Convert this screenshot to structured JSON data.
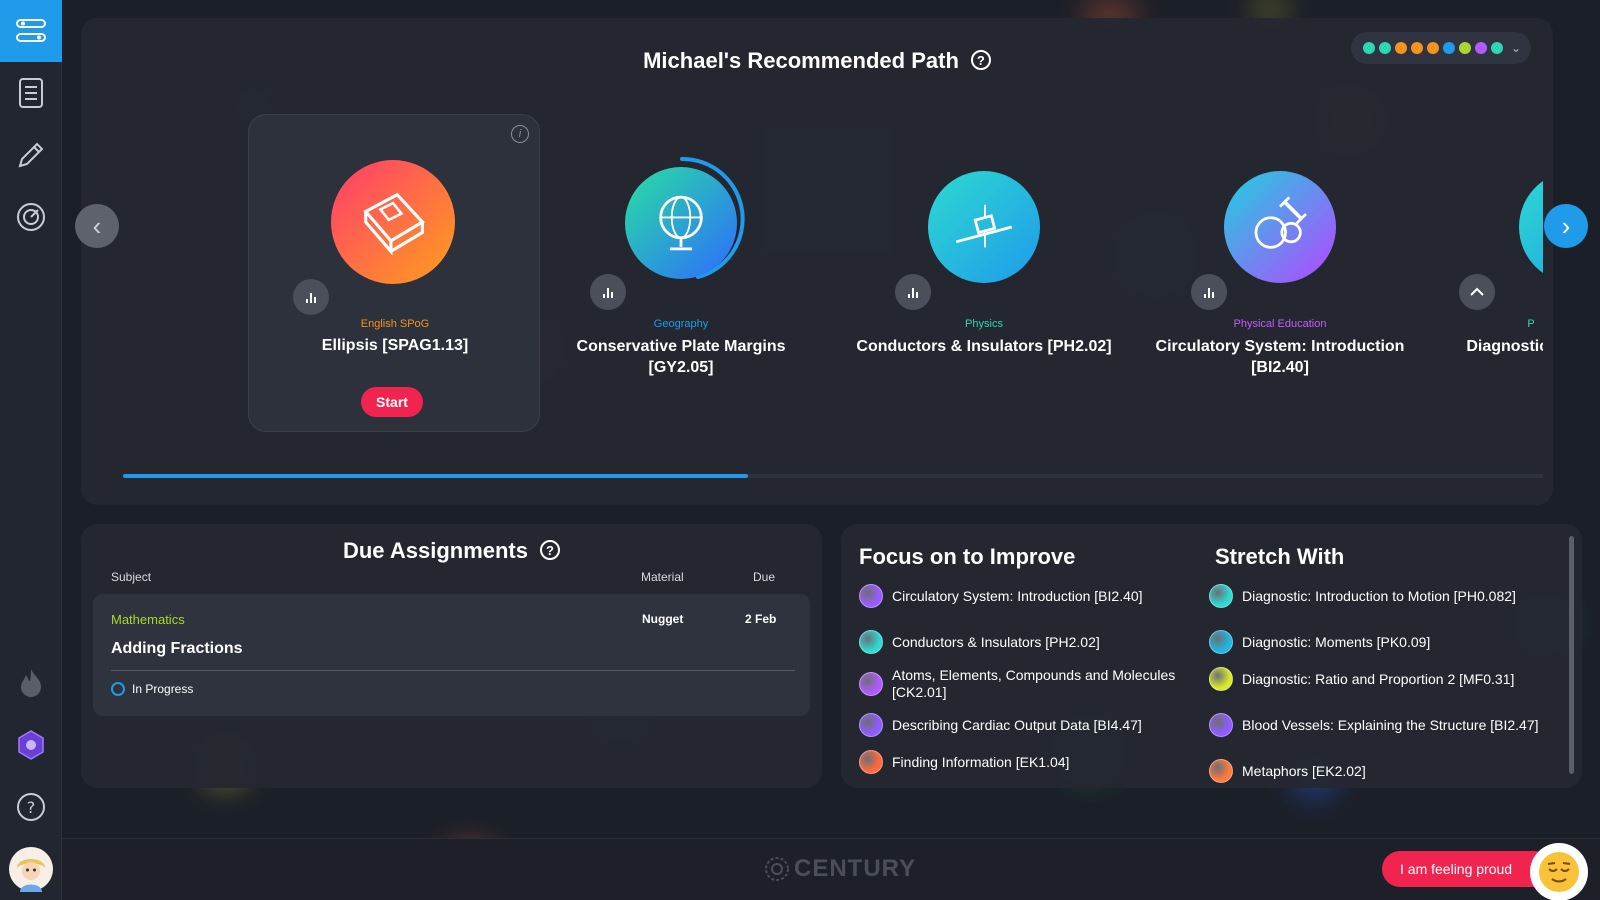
{
  "sidebar": {
    "items": [
      {
        "icon": "path-icon",
        "active": true
      },
      {
        "icon": "assignments-icon"
      },
      {
        "icon": "pencil-icon"
      },
      {
        "icon": "dashboard-icon"
      },
      {
        "icon": "flame-icon"
      },
      {
        "icon": "badge-icon"
      },
      {
        "icon": "help-icon"
      },
      {
        "icon": "avatar-icon"
      }
    ]
  },
  "recommended_path": {
    "title": "Michael's Recommended Path",
    "help_glyph": "?",
    "color_dots": [
      "#2fd6b4",
      "#2fd6b4",
      "#f7941d",
      "#f7941d",
      "#f7941d",
      "#1f9bea",
      "#a8d82d",
      "#b05bff",
      "#2fd6b4"
    ],
    "scroll_progress": 0.44,
    "cards": [
      {
        "subject": "English SPoG",
        "subject_color": "#f7941d",
        "title": "Ellipsis [SPAG1.13]",
        "button": "Start",
        "colors": [
          "#ff3c6d",
          "#ff9f1c"
        ],
        "icon": "book-icon"
      },
      {
        "subject": "Geography",
        "subject_color": "#1f9bea",
        "title": "Conservative Plate Margins [GY2.05]",
        "colors": [
          "#29e0a0",
          "#2d6bff"
        ],
        "icon": "globe-icon"
      },
      {
        "subject": "Physics",
        "subject_color": "#2fd6b4",
        "title": "Conductors & Insulators [PH2.02]",
        "colors": [
          "#2dd9d1",
          "#1f9bea"
        ],
        "icon": "physics-icon"
      },
      {
        "subject": "Physical Education",
        "subject_color": "#c45cff",
        "title": "Circulatory System: Introduction [BI2.40]",
        "colors": [
          "#1fd1e0",
          "#b446ff"
        ],
        "icon": "sports-icon"
      },
      {
        "subject": "P",
        "subject_color": "#2fd6b4",
        "title": "Diagnostic: Intr [PH",
        "colors": [
          "#2dd9d1",
          "#1f9bea"
        ],
        "icon": "physics-icon"
      }
    ]
  },
  "due_assignments": {
    "title": "Due Assignments",
    "headers": {
      "subject": "Subject",
      "material": "Material",
      "due": "Due"
    },
    "rows": [
      {
        "subject": "Mathematics",
        "material": "Nugget",
        "due": "2 Feb",
        "title": "Adding Fractions",
        "status": "In Progress"
      }
    ]
  },
  "focus": {
    "title": "Focus on to Improve",
    "items": [
      {
        "label": "Circulatory System: Introduction [BI2.40]",
        "color": "#9b5cff"
      },
      {
        "label": "Conductors & Insulators [PH2.02]",
        "color": "#2dd9d1"
      },
      {
        "label": "Atoms, Elements, Compounds and Molecules [CK2.01]",
        "color": "#b05bff"
      },
      {
        "label": "Describing Cardiac Output Data [BI4.47]",
        "color": "#8f5cff"
      },
      {
        "label": "Finding Information [EK1.04]",
        "color": "#ff6a3d"
      }
    ]
  },
  "stretch": {
    "title": "Stretch With",
    "items": [
      {
        "label": "Diagnostic: Introduction to Motion [PH0.082]",
        "color": "#2dd9d1"
      },
      {
        "label": "Diagnostic: Moments [PK0.09]",
        "color": "#1fb6e0"
      },
      {
        "label": "Diagnostic: Ratio and Proportion 2 [MF0.31]",
        "color": "#d7e82d"
      },
      {
        "label": "Blood Vessels: Explaining the Structure [BI2.47]",
        "color": "#8f5cff"
      },
      {
        "label": "Metaphors [EK2.02]",
        "color": "#ff7a3d"
      }
    ]
  },
  "footer": {
    "logo": "CENTURY",
    "proud_button": "I am feeling proud"
  },
  "colors": {
    "accent": "#1f9bea",
    "start": "#f0244f",
    "panel": "#242831",
    "background": "#1b1f28"
  }
}
